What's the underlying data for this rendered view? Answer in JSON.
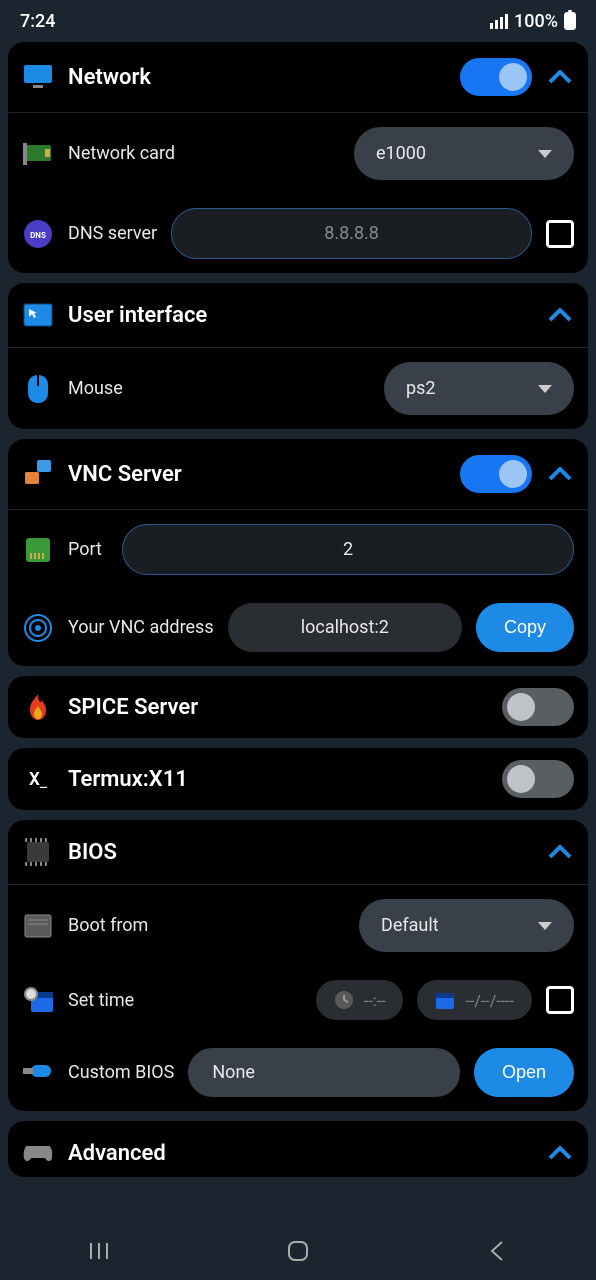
{
  "status": {
    "time": "7:24",
    "battery": "100%"
  },
  "network": {
    "title": "Network",
    "card": {
      "label": "Network card",
      "value": "e1000"
    },
    "dns": {
      "label": "DNS server",
      "placeholder": "8.8.8.8"
    }
  },
  "ui": {
    "title": "User interface",
    "mouse": {
      "label": "Mouse",
      "value": "ps2"
    }
  },
  "vnc": {
    "title": "VNC Server",
    "port": {
      "label": "Port",
      "value": "2"
    },
    "address": {
      "label": "Your VNC address",
      "value": "localhost:2",
      "copy": "Copy"
    }
  },
  "spice": {
    "title": "SPICE Server"
  },
  "termux": {
    "title": "Termux:X11"
  },
  "bios": {
    "title": "BIOS",
    "boot": {
      "label": "Boot from",
      "value": "Default"
    },
    "time": {
      "label": "Set time",
      "time_placeholder": "--:--",
      "date_placeholder": "--/--/----"
    },
    "custom": {
      "label": "Custom BIOS",
      "value": "None",
      "open": "Open"
    }
  },
  "advanced": {
    "title": "Advanced"
  }
}
